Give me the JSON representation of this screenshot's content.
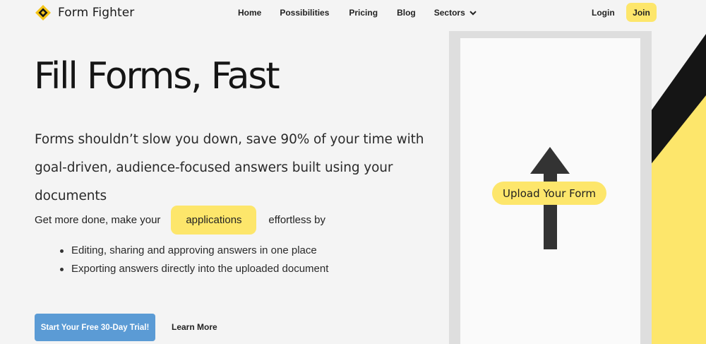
{
  "brand": {
    "name": "Form Fighter"
  },
  "nav": {
    "items": [
      "Home",
      "Possibilities",
      "Pricing",
      "Blog",
      "Sectors"
    ],
    "login": "Login",
    "join": "Join"
  },
  "hero": {
    "title": "Fill Forms, Fast",
    "subtitle": "Forms shouldn’t slow you down, save 90% of your time with goal-driven, audience-focused answers built using your documents",
    "get_more_prefix": "Get more done, make your",
    "highlight_word": "applications",
    "get_more_suffix": "effortless by",
    "bullets": [
      "Editing, sharing and approving answers in one place",
      "Exporting answers directly into the uploaded document"
    ],
    "cta": "Start Your Free 30-Day Trial!",
    "learn_more": "Learn More"
  },
  "illustration": {
    "upload_label": "Upload Your Form"
  },
  "colors": {
    "accent_yellow": "#fde66b",
    "cta_blue": "#5b9bd5",
    "background": "#f4f4f4"
  },
  "icons": {
    "logo": "diamond-logo-icon",
    "dropdown": "chevron-down-icon",
    "upload": "arrow-up-icon"
  }
}
